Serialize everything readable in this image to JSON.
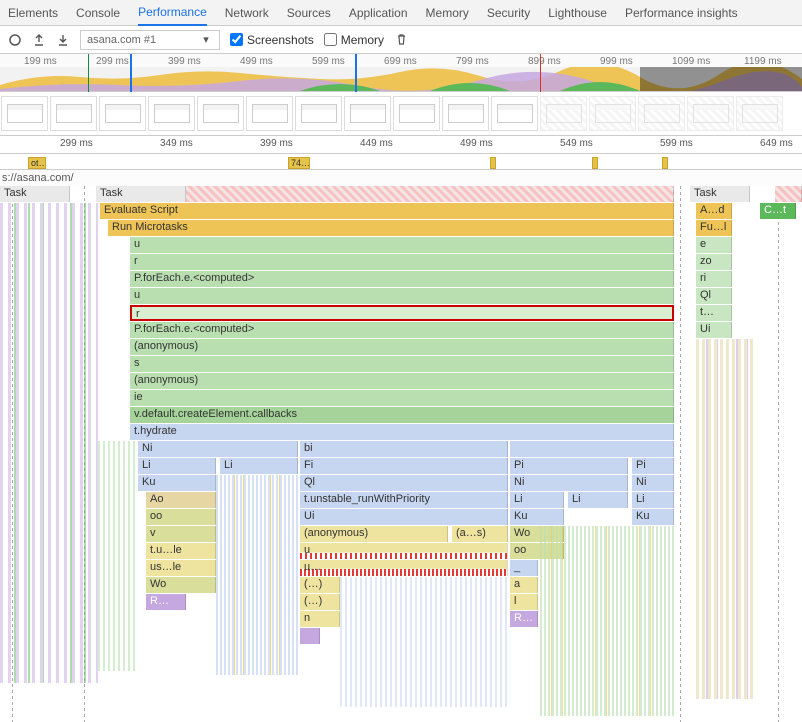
{
  "tabs": {
    "elements": "Elements",
    "console": "Console",
    "performance": "Performance",
    "network": "Network",
    "sources": "Sources",
    "application": "Application",
    "memory": "Memory",
    "security": "Security",
    "lighthouse": "Lighthouse",
    "insights": "Performance insights"
  },
  "toolbar": {
    "dropdown": "asana.com #1",
    "screenshots": "Screenshots",
    "memory": "Memory"
  },
  "overview_times": [
    "199 ms",
    "299 ms",
    "399 ms",
    "499 ms",
    "599 ms",
    "699 ms",
    "799 ms",
    "899 ms",
    "999 ms",
    "1099 ms",
    "1199 ms"
  ],
  "ruler_times": [
    "299 ms",
    "349 ms",
    "399 ms",
    "449 ms",
    "499 ms",
    "549 ms",
    "599 ms",
    "649 ms"
  ],
  "markers": {
    "ot": "ot…",
    "seventyfour": "74…"
  },
  "url": "s://asana.com/",
  "flame": {
    "task": "Task",
    "a_d": "A…d",
    "c_t": "C…t",
    "evaluate": "Evaluate Script",
    "fu_l": "Fu…l",
    "run_micro": "Run Microtasks",
    "e": "e",
    "u": "u",
    "zo": "zo",
    "r": "r",
    "ri": "ri",
    "pforeach": "P.forEach.e.<computed>",
    "ql": "Ql",
    "t_dots": "t…",
    "ui": "Ui",
    "anonymous": "(anonymous)",
    "s": "s",
    "ie": "ie",
    "vdefault": "v.default.createElement.callbacks",
    "thydrate": "t.hydrate",
    "ni": "Ni",
    "bi": "bi",
    "li": "Li",
    "fi": "Fi",
    "pi": "Pi",
    "ku": "Ku",
    "trun": "t.unstable_runWithPriority",
    "ao": "Ao",
    "oo": "oo",
    "wo": "Wo",
    "v": "v",
    "tu_le": "t.u…le",
    "us_le": "us…le",
    "u_dots": "u…",
    "r_dots2": "R…",
    "paren": "(…)",
    "under": "_",
    "a": "a",
    "l": "l",
    "n": "n",
    "a_s": "(a…s)"
  }
}
